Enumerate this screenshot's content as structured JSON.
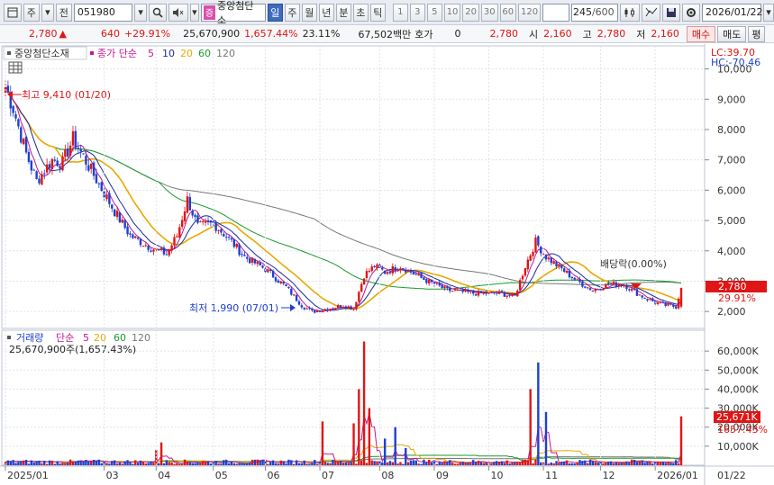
{
  "toolbar": {
    "market_label": "주",
    "prev_label": "전",
    "code": "051980",
    "stock_badge": "증",
    "stock_name": "중앙첨단소",
    "periods": [
      "일",
      "주",
      "월",
      "년",
      "분",
      "초",
      "틱"
    ],
    "intervals": [
      "1",
      "3",
      "5",
      "10",
      "20",
      "30",
      "60",
      "120"
    ],
    "count": "245",
    "count_max": "/600",
    "date": "2026/01/22"
  },
  "quote": {
    "price": "2,780",
    "change": "640",
    "change_pct": "+29.91%",
    "volume": "25,670,900",
    "volume_ratio": "1,657.44%",
    "turnover": "23.11%",
    "amount": "67,502백만",
    "ask_label": "호가",
    "ask_value": "0",
    "ask_price": "2,780",
    "open_label": "시",
    "open": "2,160",
    "high_label": "고",
    "high": "2,780",
    "low_label": "저",
    "low": "2,160",
    "buy_label": "매수",
    "sell_label": "매도",
    "eval_label": "평"
  },
  "price_panel": {
    "legend_name": "중앙첨단소재",
    "legend_ma": "종가 단순",
    "ma_periods": [
      "5",
      "10",
      "20",
      "60",
      "120"
    ],
    "lc": "LC:39.70",
    "hc": "HC:-70.46",
    "high_annotation": "최고 9,410 (01/20)",
    "low_annotation": "최저 1,990 (07/01)",
    "dividend_annotation": "배당락(0.00%)",
    "price_tag": "2,780",
    "pct_tag": "29.91%",
    "y_ticks": [
      "10,000",
      "9,000",
      "8,000",
      "7,000",
      "6,000",
      "5,000",
      "4,000",
      "3,000",
      "2,000"
    ]
  },
  "volume_panel": {
    "legend_name": "거래량",
    "legend_ma": "단순",
    "ma_periods": [
      "5",
      "20",
      "60",
      "120"
    ],
    "last_volume": "25,670,900주(1,657.43%)",
    "vol_tag": "25,671K",
    "vol_pct_tag": "1657.43%",
    "y_ticks": [
      "60,000K",
      "50,000K",
      "40,000K",
      "30,000K",
      "20,000K",
      "10,000K"
    ]
  },
  "x_axis": {
    "labels": [
      "2025/01",
      "03",
      "04",
      "05",
      "06",
      "07",
      "08",
      "09",
      "10",
      "11",
      "12",
      "2026/01"
    ],
    "right_label": "01/22"
  },
  "colors": {
    "up": "#e01515",
    "down": "#1f3fd0",
    "ma5": "#c01890",
    "ma10": "#1a2a9a",
    "ma20": "#e8a800",
    "ma60": "#1a9a2a",
    "ma120": "#777777"
  },
  "chart_data": {
    "type": "line",
    "price_series_anchors": [
      [
        0,
        9410
      ],
      [
        3,
        8700
      ],
      [
        8,
        7200
      ],
      [
        12,
        6300
      ],
      [
        18,
        7000
      ],
      [
        22,
        6900
      ],
      [
        26,
        7700
      ],
      [
        30,
        7100
      ],
      [
        36,
        6200
      ],
      [
        42,
        5300
      ],
      [
        48,
        4500
      ],
      [
        56,
        4100
      ],
      [
        62,
        3900
      ],
      [
        66,
        4500
      ],
      [
        70,
        5700
      ],
      [
        74,
        4800
      ],
      [
        80,
        4900
      ],
      [
        86,
        4400
      ],
      [
        92,
        3800
      ],
      [
        100,
        3400
      ],
      [
        108,
        2800
      ],
      [
        114,
        2200
      ],
      [
        118,
        1990
      ],
      [
        124,
        2100
      ],
      [
        130,
        2200
      ],
      [
        134,
        2100
      ],
      [
        138,
        3200
      ],
      [
        142,
        3500
      ],
      [
        146,
        3300
      ],
      [
        152,
        3500
      ],
      [
        160,
        3100
      ],
      [
        170,
        2700
      ],
      [
        180,
        2600
      ],
      [
        190,
        2600
      ],
      [
        196,
        2500
      ],
      [
        200,
        3500
      ],
      [
        204,
        4300
      ],
      [
        208,
        3800
      ],
      [
        214,
        3400
      ],
      [
        220,
        3000
      ],
      [
        226,
        2700
      ],
      [
        232,
        2900
      ],
      [
        238,
        2900
      ],
      [
        242,
        2650
      ],
      [
        246,
        2450
      ],
      [
        250,
        2300
      ],
      [
        254,
        2200
      ],
      [
        258,
        2160
      ],
      [
        260,
        2780
      ]
    ],
    "volume_spikes_k": [
      [
        138,
        65000
      ],
      [
        136,
        40000
      ],
      [
        140,
        30000
      ],
      [
        134,
        22000
      ],
      [
        150,
        20000
      ],
      [
        122,
        23000
      ],
      [
        205,
        54000
      ],
      [
        202,
        40000
      ],
      [
        208,
        28000
      ],
      [
        260,
        25671
      ],
      [
        60,
        12000
      ],
      [
        58,
        8000
      ],
      [
        146,
        14000
      ],
      [
        154,
        9000
      ]
    ],
    "ylim_price": [
      1500,
      10700
    ],
    "ylim_volume": [
      0,
      70000
    ]
  }
}
